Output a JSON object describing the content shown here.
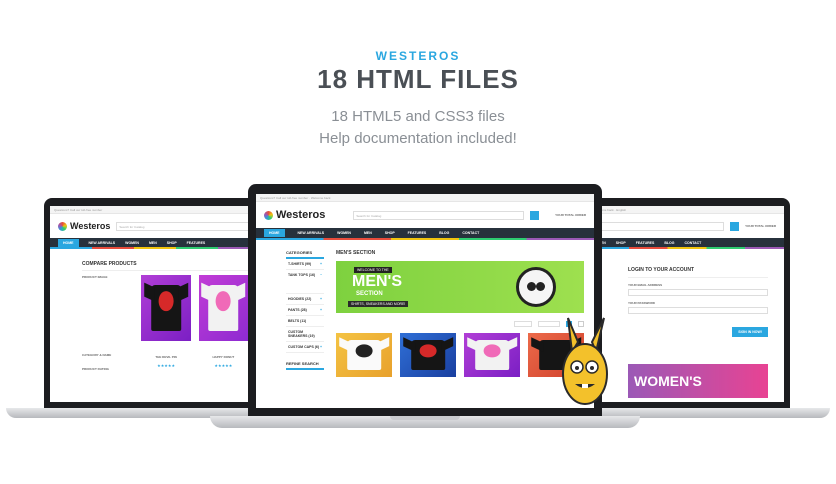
{
  "promo": {
    "brand": "WESTEROS",
    "title": "18 HTML FILES",
    "line1": "18 HTML5 and CSS3 files",
    "line2": "Help documentation included!"
  },
  "site": {
    "logo": "Westeros",
    "search_placeholder": "Search for Catalog",
    "cart_label": "YOUR TOTAL ORDER",
    "nav": [
      "HOME",
      "NEW ARRIVALS",
      "WOMEN",
      "MEN",
      "SHOP",
      "FEATURES",
      "BLOG",
      "CONTACT"
    ]
  },
  "left_screen": {
    "heading": "COMPARE PRODUCTS",
    "rows": [
      "PRODUCT IMAGE",
      "CATEGORY & NAME",
      "PRODUCT RATING"
    ],
    "products": [
      "THE DEVIL PIN",
      "HAPPY DONUT"
    ]
  },
  "center_screen": {
    "categories_title": "CATEGORIES",
    "categories": [
      "T-SHIRTS (99)",
      "TANK TOPS (16)",
      "HOODIES (22)",
      "PANTS (28)",
      "BELTS (11)",
      "CUSTOM SNEAKERS (19)",
      "CUSTOM CAPS (6)"
    ],
    "refine_title": "REFINE SEARCH",
    "section_title": "MEN'S SECTION",
    "banner_top": "WELCOME TO THE",
    "banner_main": "MEN'S",
    "banner_sub": "SECTION",
    "banner_tag": "SHIRTS, SNEAKERS AND MORE!"
  },
  "right_screen": {
    "heading": "LOGIN TO YOUR ACCOUNT",
    "email_label": "YOUR EMAIL ADDRESS",
    "password_label": "YOUR PASSWORD",
    "signin": "SIGN IN NOW!",
    "banner_main": "WOMEN'S"
  },
  "colors": {
    "accent": "#2aa7e0",
    "nav": "#27313c",
    "men_banner": "#8fd94a",
    "women_banner": "#c04fb0",
    "mascot": "#f3c12b"
  }
}
